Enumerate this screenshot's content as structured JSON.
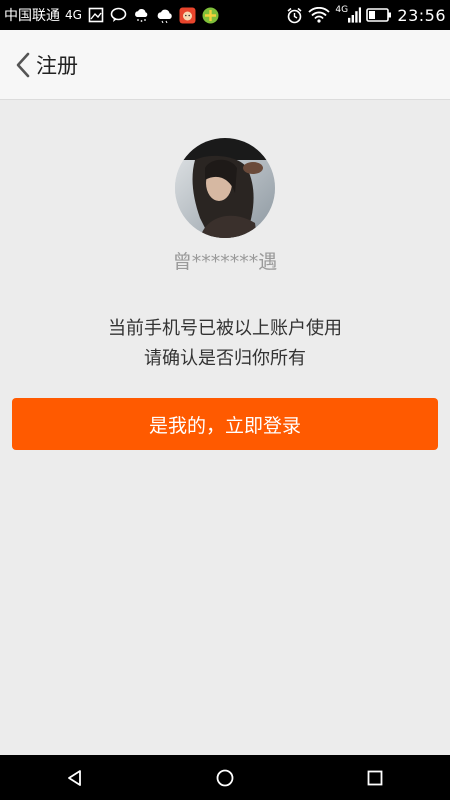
{
  "status_bar": {
    "carrier": "中国联通",
    "network": "4G",
    "network_tag": "4G",
    "time": "23:56",
    "icons_left": [
      "image-icon",
      "chat-bubble-icon",
      "weather-icon",
      "cloud-icon",
      "app-badge-icon",
      "app-icon"
    ],
    "icons_right": [
      "alarm-icon",
      "wifi-icon",
      "signal-icon",
      "battery-icon"
    ]
  },
  "header": {
    "title": "注册",
    "back_icon": "chevron-left-icon"
  },
  "account": {
    "masked_name": "曾*******遇"
  },
  "message": {
    "line1": "当前手机号已被以上账户使用",
    "line2": "请确认是否归你所有"
  },
  "actions": {
    "confirm_label": "是我的，立即登录",
    "confirm_color": "#ff5a00"
  },
  "nav_bar": {
    "icons": [
      "back-triangle-icon",
      "home-circle-icon",
      "recents-square-icon"
    ]
  }
}
